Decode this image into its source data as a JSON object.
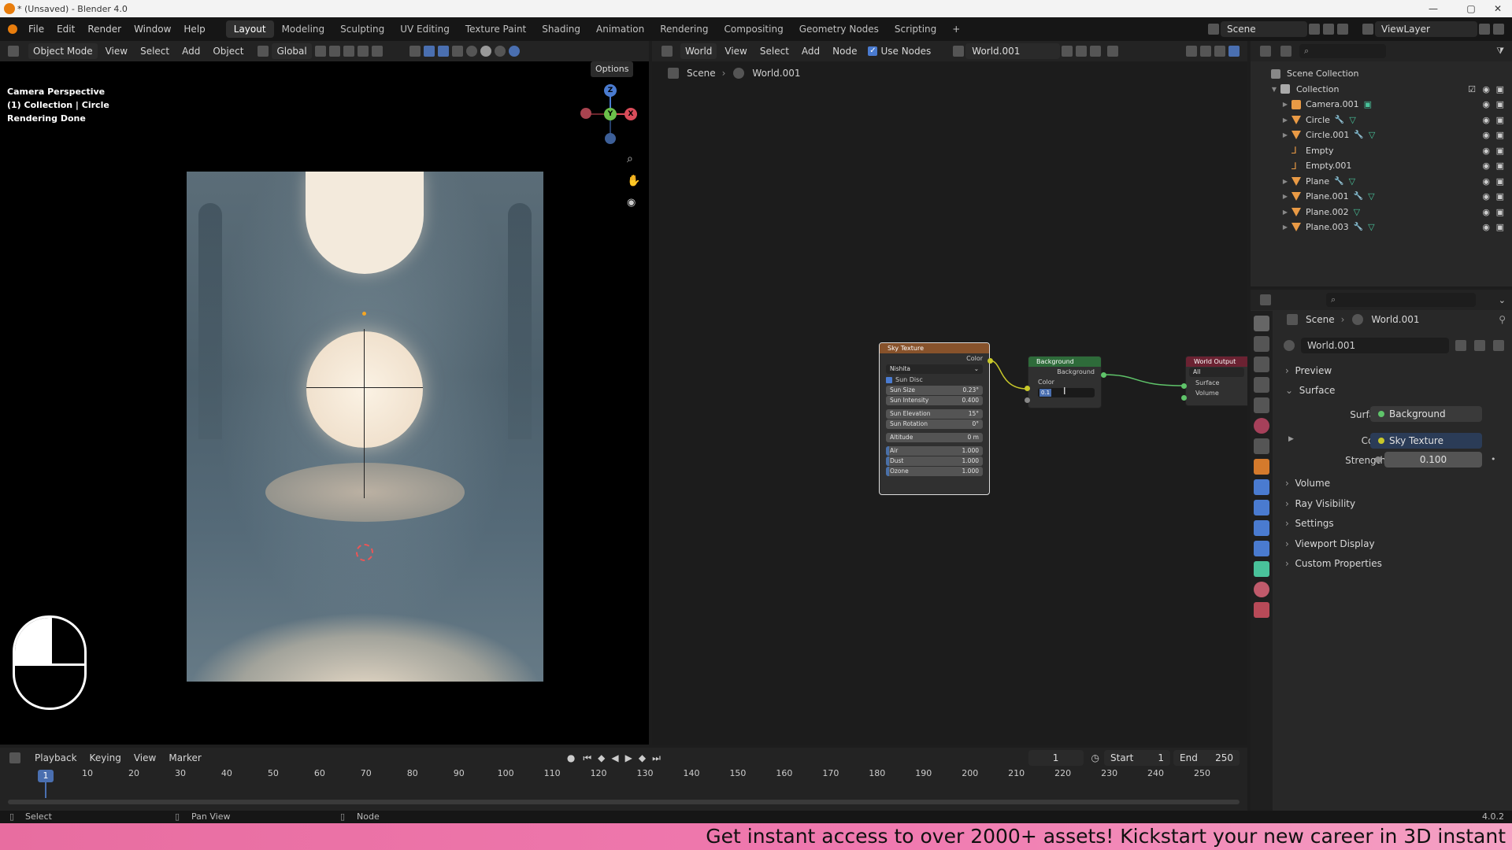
{
  "title": "* (Unsaved) - Blender 4.0",
  "menus": [
    "File",
    "Edit",
    "Render",
    "Window",
    "Help"
  ],
  "workspaces": [
    "Layout",
    "Modeling",
    "Sculpting",
    "UV Editing",
    "Texture Paint",
    "Shading",
    "Animation",
    "Rendering",
    "Compositing",
    "Geometry Nodes",
    "Scripting"
  ],
  "active_workspace": "Layout",
  "scene_field": "Scene",
  "viewlayer_field": "ViewLayer",
  "viewport": {
    "mode": "Object Mode",
    "menus": [
      "View",
      "Select",
      "Add",
      "Object"
    ],
    "transform": "Global",
    "options": "Options",
    "info": [
      "Camera Perspective",
      "(1) Collection | Circle",
      "Rendering Done"
    ],
    "gizmo": {
      "x": "X",
      "y": "Y",
      "z": "Z"
    }
  },
  "node_editor": {
    "world_type": "World",
    "menus": [
      "View",
      "Select",
      "Add",
      "Node"
    ],
    "use_nodes_label": "Use Nodes",
    "world_name": "World.001",
    "breadcrumb": [
      "Scene",
      "World.001"
    ],
    "sky_texture": {
      "title": "Sky Texture",
      "output": "Color",
      "type": "Nishita",
      "sun_disc": "Sun Disc",
      "fields": [
        {
          "label": "Sun Size",
          "value": "0.23°"
        },
        {
          "label": "Sun Intensity",
          "value": "0.400"
        },
        {
          "label": "Sun Elevation",
          "value": "15°"
        },
        {
          "label": "Sun Rotation",
          "value": "0°"
        },
        {
          "label": "Altitude",
          "value": "0 m"
        },
        {
          "label": "Air",
          "value": "1.000"
        },
        {
          "label": "Dust",
          "value": "1.000"
        },
        {
          "label": "Ozone",
          "value": "1.000"
        }
      ]
    },
    "background": {
      "title": "Background",
      "output": "Background",
      "color": "Color",
      "strength_value": "0.1"
    },
    "world_output": {
      "title": "World Output",
      "target": "All",
      "surface": "Surface",
      "volume": "Volume"
    }
  },
  "outliner": {
    "root": "Scene Collection",
    "collection": "Collection",
    "items": [
      {
        "name": "Camera.001",
        "kind": "camera",
        "expand": true,
        "mod": false,
        "mesh": false
      },
      {
        "name": "Circle",
        "kind": "mesh",
        "expand": true,
        "mod": true,
        "mesh": true
      },
      {
        "name": "Circle.001",
        "kind": "mesh",
        "expand": true,
        "mod": true,
        "mesh": true
      },
      {
        "name": "Empty",
        "kind": "empty",
        "expand": false,
        "mod": false,
        "mesh": false
      },
      {
        "name": "Empty.001",
        "kind": "empty",
        "expand": false,
        "mod": false,
        "mesh": false
      },
      {
        "name": "Plane",
        "kind": "mesh",
        "expand": true,
        "mod": true,
        "mesh": true
      },
      {
        "name": "Plane.001",
        "kind": "mesh",
        "expand": true,
        "mod": true,
        "mesh": true
      },
      {
        "name": "Plane.002",
        "kind": "mesh",
        "expand": true,
        "mod": false,
        "mesh": true
      },
      {
        "name": "Plane.003",
        "kind": "mesh",
        "expand": true,
        "mod": true,
        "mesh": true
      }
    ]
  },
  "properties": {
    "breadcrumb": [
      "Scene",
      "World.001"
    ],
    "world_name": "World.001",
    "panels": [
      "Preview",
      "Surface",
      "Volume",
      "Ray Visibility",
      "Settings",
      "Viewport Display",
      "Custom Properties"
    ],
    "surface_label": "Surface",
    "surface_value": "Background",
    "color_label": "Color",
    "color_value": "Sky Texture",
    "strength_label": "Strength",
    "strength_value": "0.100"
  },
  "timeline": {
    "menus": [
      "Playback",
      "Keying",
      "View",
      "Marker"
    ],
    "current_frame": "1",
    "start_label": "Start",
    "start": "1",
    "end_label": "End",
    "end": "250",
    "ticks": [
      "1",
      "10",
      "20",
      "30",
      "40",
      "50",
      "60",
      "70",
      "80",
      "90",
      "100",
      "110",
      "120",
      "130",
      "140",
      "150",
      "160",
      "170",
      "180",
      "190",
      "200",
      "210",
      "220",
      "230",
      "240",
      "250"
    ]
  },
  "status": {
    "select": "Select",
    "pan": "Pan View",
    "node": "Node",
    "version": "4.0.2"
  },
  "banner": "Get instant access to over 2000+ assets! Kickstart your new career in 3D instant"
}
